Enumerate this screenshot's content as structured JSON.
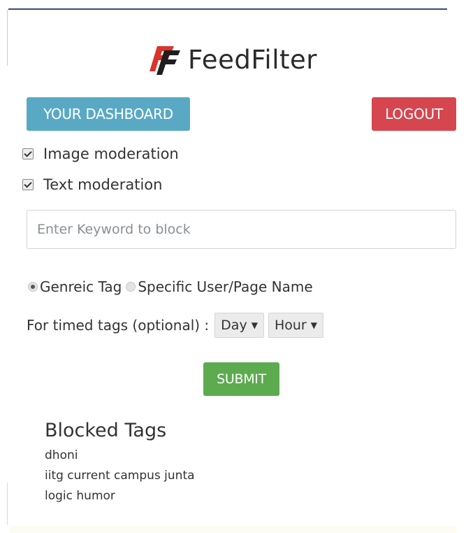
{
  "brand": {
    "name": "FeedFilter",
    "logo_icon": "feedfilter-ff-logo-icon",
    "logo_color": "#d9342b"
  },
  "header": {
    "dashboard_label": "YOUR DASHBOARD",
    "dashboard_color": "#5aa9c4",
    "logout_label": "LOGOUT",
    "logout_color": "#d5464f"
  },
  "moderation": {
    "options": [
      {
        "label": "Image moderation",
        "checked": true
      },
      {
        "label": "Text moderation",
        "checked": true
      }
    ]
  },
  "keyword": {
    "placeholder": "Enter Keyword to block",
    "value": ""
  },
  "tag_type": {
    "options": [
      {
        "label": "Genreic Tag",
        "selected": true
      },
      {
        "label": "Specific User/Page Name",
        "selected": false
      }
    ]
  },
  "timed": {
    "label": "For timed tags (optional) :",
    "day_value": "Day",
    "hour_value": "Hour"
  },
  "submit": {
    "label": "SUBMIT",
    "color": "#5cab4f"
  },
  "blocked": {
    "title": "Blocked Tags",
    "items": [
      "dhoni",
      "iitg current campus junta",
      "logic humor"
    ]
  }
}
